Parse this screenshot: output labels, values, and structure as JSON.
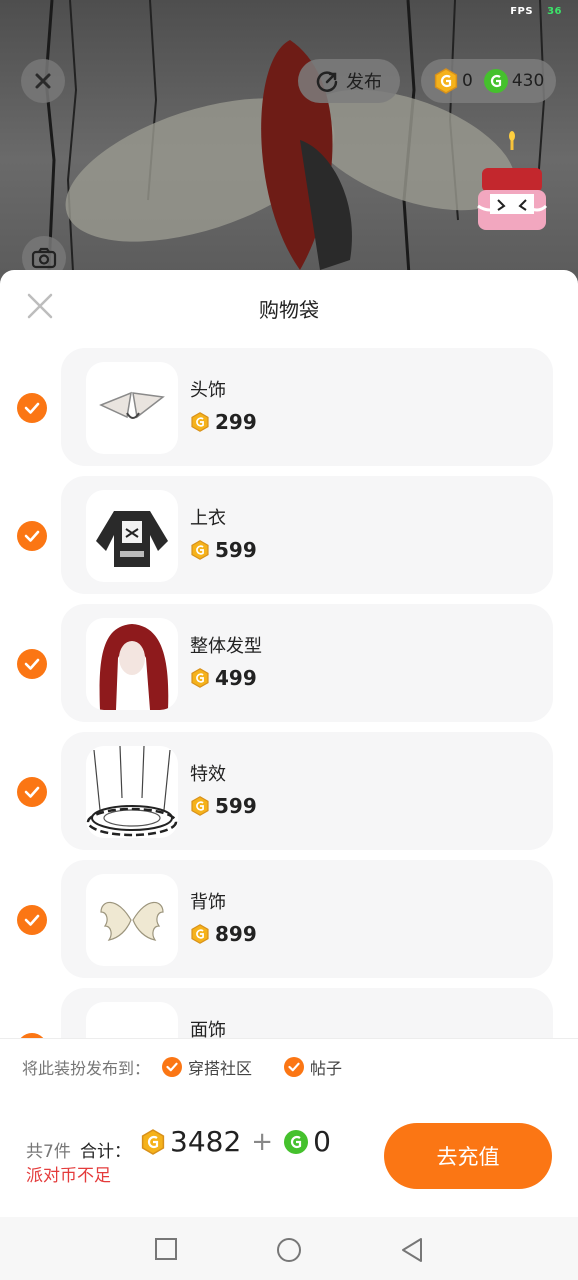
{
  "status": {
    "fps_label": "FPS",
    "fps_value": "36"
  },
  "top": {
    "publish_label": "发布",
    "gold_coin_amount": "0",
    "green_coin_amount": "430"
  },
  "sheet": {
    "title": "购物袋",
    "items": [
      {
        "name": "头饰",
        "price": "299",
        "checked": true,
        "thumb": "headwear"
      },
      {
        "name": "上衣",
        "price": "599",
        "checked": true,
        "thumb": "top-clothing"
      },
      {
        "name": "整体发型",
        "price": "499",
        "checked": true,
        "thumb": "hairstyle"
      },
      {
        "name": "特效",
        "price": "599",
        "checked": true,
        "thumb": "effect"
      },
      {
        "name": "背饰",
        "price": "899",
        "checked": true,
        "thumb": "back-wings"
      },
      {
        "name": "面饰",
        "price": "",
        "checked": true,
        "thumb": "face-accessory"
      }
    ],
    "publish_to_label": "将此装扮发布到：",
    "publish_options": [
      "穿搭社区",
      "帖子"
    ],
    "item_count": "共7件",
    "total_label": "合计：",
    "total_gold": "3482",
    "total_plus": "+",
    "total_green": "0",
    "warning": "派对币不足",
    "recharge_label": "去充值"
  },
  "colors": {
    "accent": "#fb7614",
    "warning": "#e43c3c",
    "gold_coin": "#f5b21b",
    "green_coin": "#45c12d"
  },
  "navbar": [
    "recent-apps-icon",
    "home-icon",
    "back-icon"
  ]
}
